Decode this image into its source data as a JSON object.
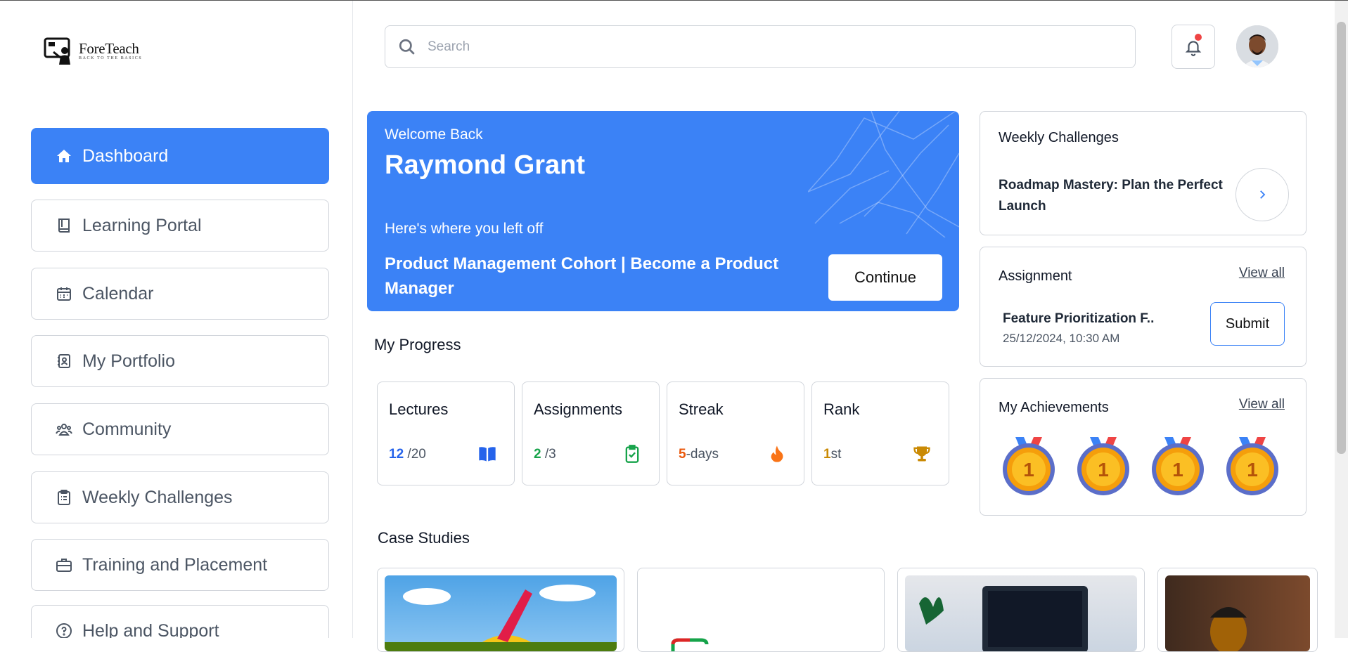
{
  "app": {
    "brand_name": "ForeTeach",
    "brand_tagline": "BACK TO THE BASICS"
  },
  "sidebar": {
    "items": [
      {
        "label": "Dashboard",
        "icon": "home-icon",
        "active": true
      },
      {
        "label": "Learning Portal",
        "icon": "book-icon"
      },
      {
        "label": "Calendar",
        "icon": "calendar-icon"
      },
      {
        "label": "My Portfolio",
        "icon": "portfolio-icon"
      },
      {
        "label": "Community",
        "icon": "community-icon"
      },
      {
        "label": "Weekly Challenges",
        "icon": "clipboard-icon"
      },
      {
        "label": "Training and Placement",
        "icon": "briefcase-icon"
      },
      {
        "label": "Help and Support",
        "icon": "help-icon"
      }
    ]
  },
  "header": {
    "search_placeholder": "Search",
    "notification_indicator": true
  },
  "welcome": {
    "greeting": "Welcome Back",
    "name": "Raymond Grant",
    "left_off": "Here's where you left off",
    "course": "Product Management Cohort | Become a Product Manager",
    "continue_label": "Continue"
  },
  "progress": {
    "title": "My Progress",
    "stats": [
      {
        "title": "Lectures",
        "value": "12",
        "suffix": " /20",
        "color": "#2563eb",
        "icon": "open-book-icon"
      },
      {
        "title": "Assignments",
        "value": "2",
        "suffix": " /3",
        "color": "#16a34a",
        "icon": "clipboard-check-icon"
      },
      {
        "title": "Streak",
        "value": "5",
        "suffix": "-days",
        "color": "#ea580c",
        "icon": "flame-icon"
      },
      {
        "title": "Rank",
        "value": "1",
        "suffix": "st",
        "color": "#ca8a04",
        "icon": "trophy-icon"
      }
    ]
  },
  "weekly_challenges": {
    "title": "Weekly Challenges",
    "challenge": "Roadmap Mastery: Plan the Perfect Launch"
  },
  "assignment": {
    "title": "Assignment",
    "view_all": "View all",
    "name": "Feature Prioritization F..",
    "due": "25/12/2024, 10:30 AM",
    "submit_label": "Submit"
  },
  "achievements": {
    "title": "My Achievements",
    "view_all": "View all",
    "medals": [
      "1",
      "1",
      "1",
      "1"
    ]
  },
  "case_studies": {
    "title": "Case Studies"
  },
  "colors": {
    "primary": "#3b82f6",
    "notification": "#ef4444"
  }
}
